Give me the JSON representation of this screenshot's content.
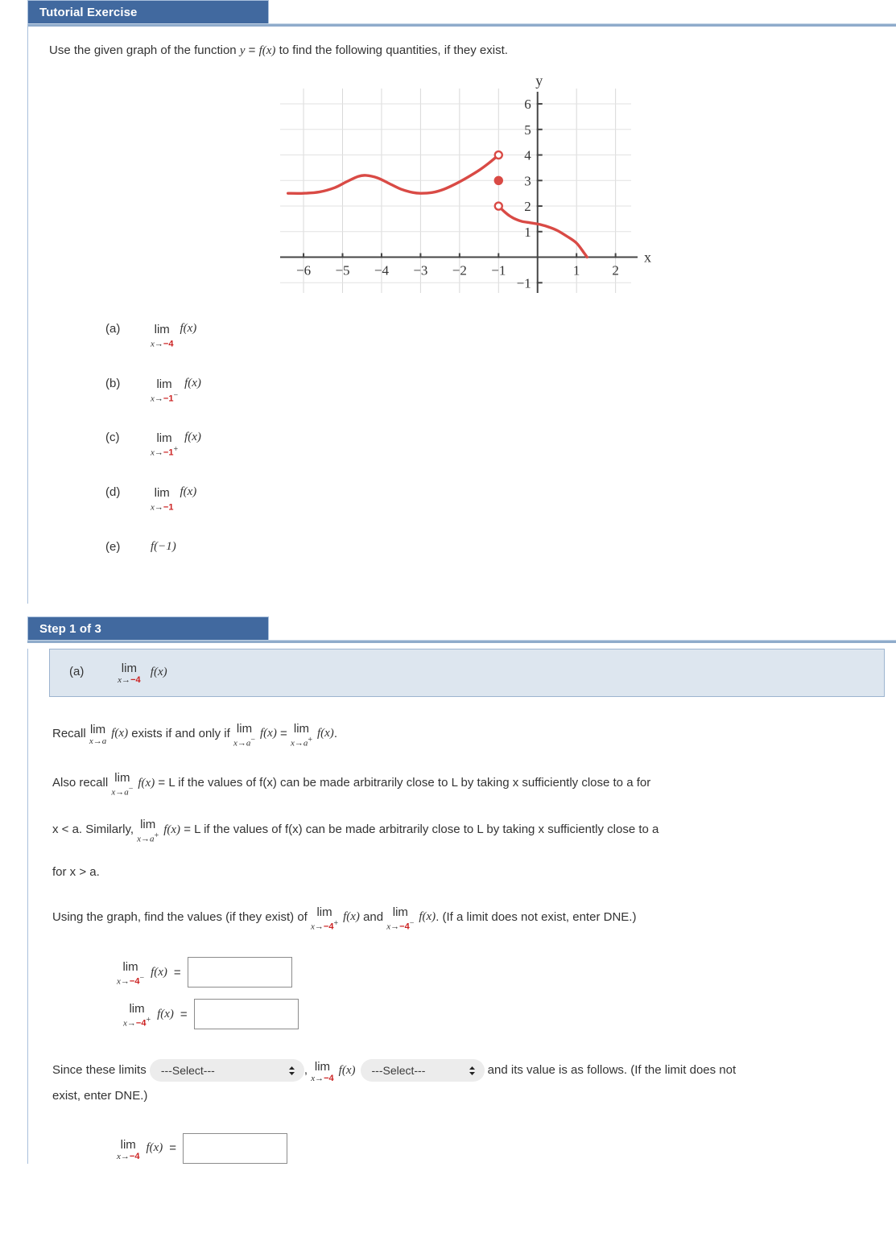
{
  "exercise": {
    "header_label": "Tutorial Exercise",
    "prompt_pre": "Use the given graph of the function ",
    "prompt_y": "y",
    "prompt_eq": " = ",
    "prompt_fx": "f(x)",
    "prompt_post": " to find the following quantities, if they exist.",
    "questions": [
      {
        "tag": "(a)",
        "op": "lim",
        "sub_var": "x→",
        "sub_val": "−4",
        "sub_sign": "",
        "body": "f(x)"
      },
      {
        "tag": "(b)",
        "op": "lim",
        "sub_var": "x→",
        "sub_val": "−1",
        "sub_sign": "−",
        "body": "f(x)"
      },
      {
        "tag": "(c)",
        "op": "lim",
        "sub_var": "x→",
        "sub_val": "−1",
        "sub_sign": "+",
        "body": "f(x)"
      },
      {
        "tag": "(d)",
        "op": "lim",
        "sub_var": "x→",
        "sub_val": "−1",
        "sub_sign": "",
        "body": "f(x)"
      },
      {
        "tag": "(e)",
        "op": "",
        "sub_var": "",
        "sub_val": "",
        "sub_sign": "",
        "body": "f(−1)"
      }
    ]
  },
  "chart_data": {
    "type": "line",
    "title": "",
    "xlabel": "x",
    "ylabel": "y",
    "xlim": [
      -6.6,
      2.4
    ],
    "ylim": [
      -1.4,
      6.6
    ],
    "xticks": [
      -6,
      -5,
      -4,
      -3,
      -2,
      -1,
      1,
      2
    ],
    "yticks": [
      -1,
      1,
      2,
      3,
      4,
      5,
      6
    ],
    "xtick_labels": [
      "−6",
      "−5",
      "−4",
      "−3",
      "−2",
      "−1",
      "1",
      "2"
    ],
    "ytick_labels": [
      "−1",
      "1",
      "2",
      "3",
      "4",
      "5",
      "6"
    ],
    "grid": true,
    "curve_color": "#d94a45",
    "series": [
      {
        "name": "left-branch",
        "points": [
          [
            -6.4,
            2.5
          ],
          [
            -6.0,
            2.5
          ],
          [
            -5.6,
            2.55
          ],
          [
            -5.2,
            2.72
          ],
          [
            -4.9,
            2.95
          ],
          [
            -4.6,
            3.16
          ],
          [
            -4.4,
            3.2
          ],
          [
            -4.1,
            3.1
          ],
          [
            -3.8,
            2.88
          ],
          [
            -3.5,
            2.66
          ],
          [
            -3.2,
            2.53
          ],
          [
            -3.0,
            2.5
          ],
          [
            -2.7,
            2.53
          ],
          [
            -2.4,
            2.66
          ],
          [
            -2.1,
            2.87
          ],
          [
            -1.8,
            3.12
          ],
          [
            -1.5,
            3.4
          ],
          [
            -1.25,
            3.68
          ],
          [
            -1.0,
            4.0
          ]
        ],
        "end_marker": "open"
      },
      {
        "name": "right-branch",
        "points": [
          [
            -1.0,
            2.0
          ],
          [
            -0.85,
            1.78
          ],
          [
            -0.7,
            1.6
          ],
          [
            -0.55,
            1.48
          ],
          [
            -0.4,
            1.4
          ],
          [
            -0.2,
            1.35
          ],
          [
            0.0,
            1.3
          ],
          [
            0.25,
            1.2
          ],
          [
            0.5,
            1.05
          ],
          [
            0.75,
            0.82
          ],
          [
            1.0,
            0.55
          ],
          [
            1.2,
            0.15
          ],
          [
            1.27,
            0.0
          ]
        ],
        "start_marker": "open"
      }
    ],
    "markers": [
      {
        "x": -1,
        "y": 4,
        "type": "open",
        "label": "open circle at (-1, 4)"
      },
      {
        "x": -1,
        "y": 3,
        "type": "filled",
        "label": "filled dot at (-1, 3)"
      },
      {
        "x": -1,
        "y": 2,
        "type": "open",
        "label": "open circle at (-1, 2)"
      }
    ]
  },
  "step1": {
    "header_label": "Step 1 of 3",
    "highlight": {
      "tag": "(a)",
      "op": "lim",
      "sub_var": "x→",
      "sub_val": "−4",
      "sub_sign": "",
      "body": "f(x)"
    },
    "recall": {
      "pre": "Recall ",
      "lim1_op": "lim",
      "lim1_sub": "x→a",
      "lim1_sign": "",
      "mid1": " exists if and only if ",
      "lim2_op": "lim",
      "lim2_sub": "x→a",
      "lim2_sign": "−",
      "mid2": " = ",
      "lim3_op": "lim",
      "lim3_sub": "x→a",
      "lim3_sign": "+",
      "post": ".",
      "fx": "f(x)"
    },
    "alsorecall": {
      "p1_pre": "Also recall ",
      "p1_op": "lim",
      "p1_sub": "x→a",
      "p1_sign": "−",
      "p1_post": " = L if the values of f(x) can be made arbitrarily close to L by taking x sufficiently close to a for",
      "p2_pre": "x < a. Similarly, ",
      "p2_op": "lim",
      "p2_sub": "x→a",
      "p2_sign": "+",
      "p2_post": " = L if the values of f(x) can be made arbitrarily close to L by taking x sufficiently close to a",
      "p3": "for x > a.",
      "fx": "f(x)"
    },
    "using": {
      "pre": "Using the graph, find the values (if they exist) of ",
      "l1_op": "lim",
      "l1_sub_var": "x→",
      "l1_sub_val": "−4",
      "l1_sign": "+",
      "mid": " and ",
      "l2_op": "lim",
      "l2_sub_var": "x→",
      "l2_sub_val": "−4",
      "l2_sign": "−",
      "post": ". (If a limit does not exist, enter DNE.)",
      "fx": "f(x)"
    },
    "answers": [
      {
        "op": "lim",
        "sub_var": "x→",
        "sub_val": "−4",
        "sub_sign": "−",
        "fx": "f(x)",
        "eq": "=",
        "value": "",
        "placeholder": ""
      },
      {
        "op": "lim",
        "sub_var": "x→",
        "sub_val": "−4",
        "sub_sign": "+",
        "fx": "f(x)",
        "eq": "=",
        "value": "",
        "placeholder": ""
      }
    ],
    "since": {
      "pre": "Since these limits ",
      "select1": "---Select---",
      "comma": ",",
      "l_op": "lim",
      "l_sub_var": "x→",
      "l_sub_val": "−4",
      "l_sign": "",
      "fx": "f(x)",
      "select2": "---Select---",
      "post": " and its value is as follows. (If the limit does not",
      "post2": "exist, enter DNE.)"
    },
    "final_answer": {
      "op": "lim",
      "sub_var": "x→",
      "sub_val": "−4",
      "sub_sign": "",
      "fx": "f(x)",
      "eq": "=",
      "value": "",
      "placeholder": ""
    }
  },
  "colors": {
    "header_blue": "#41699f",
    "rule_blue": "#8fabcb",
    "highlight_bg": "#dde6ef",
    "accent_red": "#cc2222",
    "curve_red": "#d94a45"
  }
}
